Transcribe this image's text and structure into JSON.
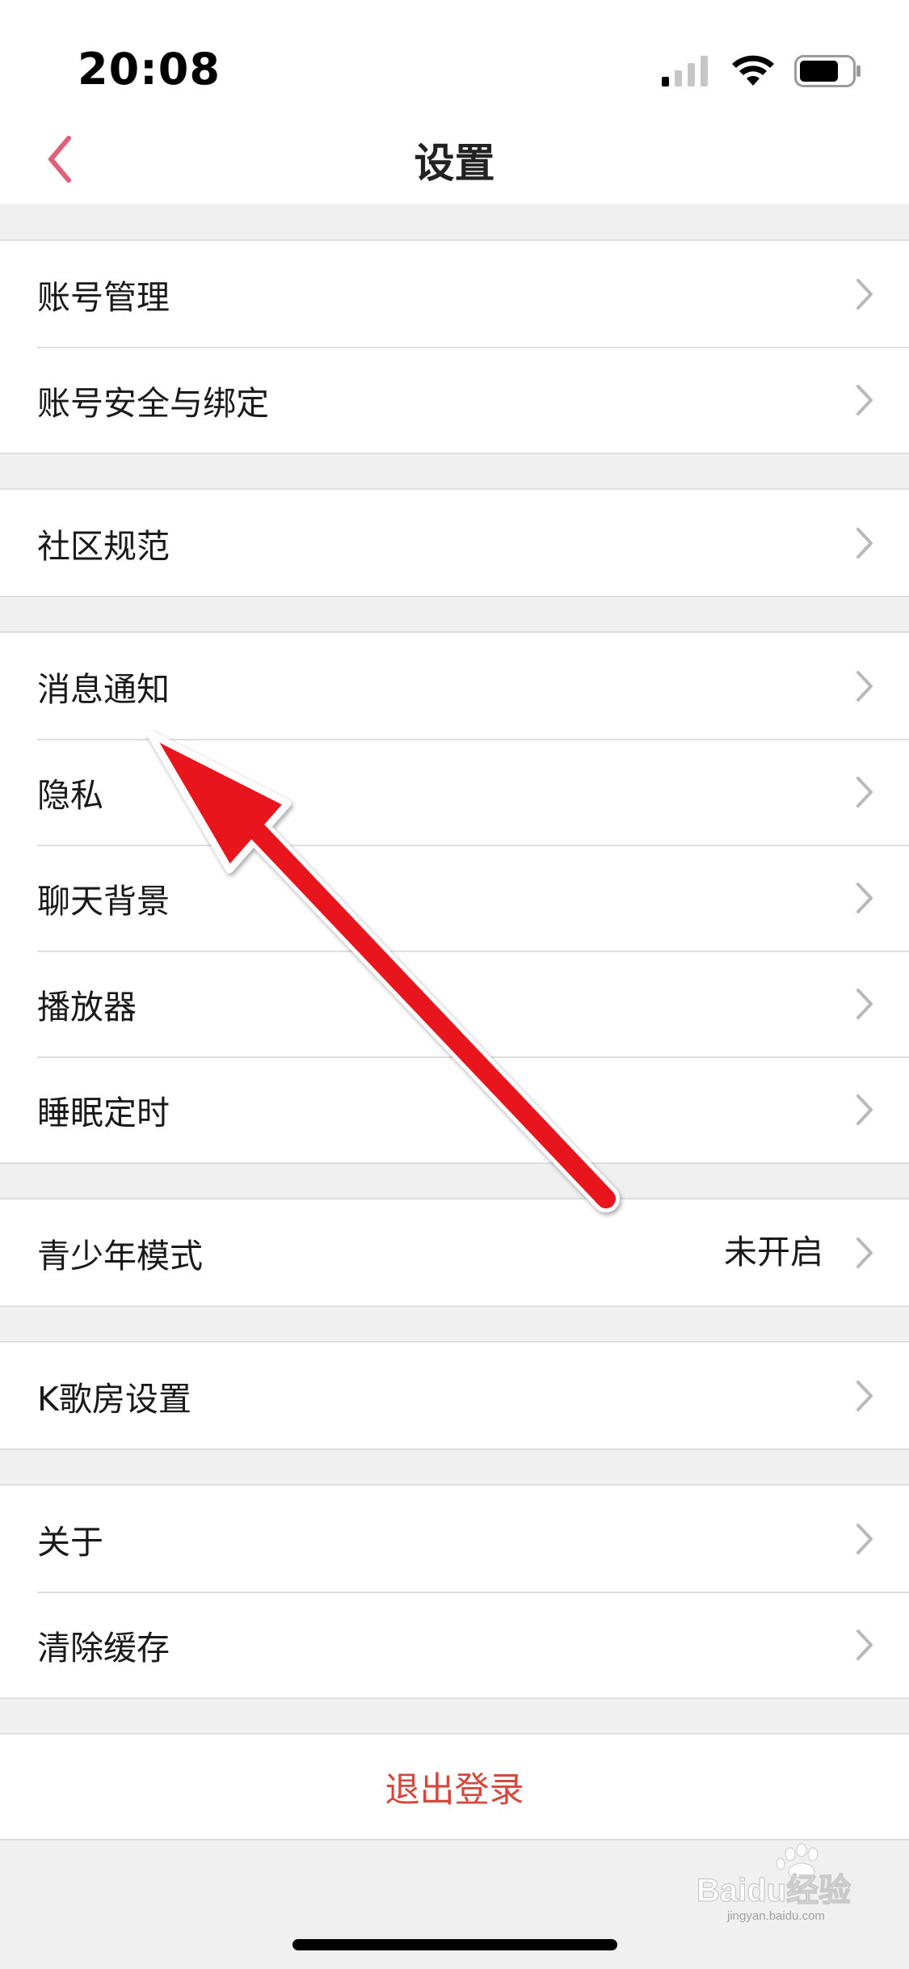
{
  "status_bar": {
    "time": "20:08",
    "signal_icon": "cellular-signal-icon",
    "wifi_icon": "wifi-icon",
    "battery_icon": "battery-icon",
    "battery_level": 0.75
  },
  "nav": {
    "title": "设置",
    "back_icon": "chevron-left-icon",
    "accent_color": "#e0607a"
  },
  "groups": [
    {
      "rows": [
        {
          "label": "账号管理"
        },
        {
          "label": "账号安全与绑定"
        }
      ]
    },
    {
      "rows": [
        {
          "label": "社区规范"
        }
      ]
    },
    {
      "rows": [
        {
          "label": "消息通知"
        },
        {
          "label": "隐私"
        },
        {
          "label": "聊天背景"
        },
        {
          "label": "播放器"
        },
        {
          "label": "睡眠定时"
        }
      ]
    },
    {
      "rows": [
        {
          "label": "青少年模式",
          "value": "未开启"
        }
      ]
    },
    {
      "rows": [
        {
          "label": "K歌房设置"
        }
      ]
    },
    {
      "rows": [
        {
          "label": "关于"
        },
        {
          "label": "清除缓存"
        }
      ]
    }
  ],
  "logout": {
    "label": "退出登录",
    "color": "#d4473c"
  },
  "watermark": {
    "text": "Baidu经验",
    "subtext": "jingyan.baidu.com"
  },
  "annotation": {
    "type": "arrow",
    "color": "#e8141c"
  }
}
